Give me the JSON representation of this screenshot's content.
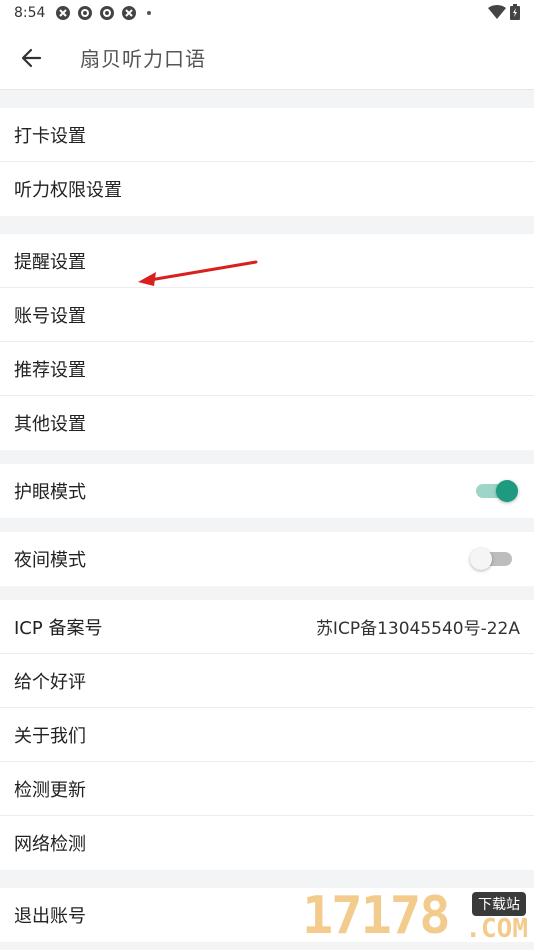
{
  "status_bar": {
    "time": "8:54",
    "icons": [
      "app-icon-1",
      "app-icon-2",
      "app-icon-3",
      "app-icon-4"
    ],
    "right_icons": [
      "wifi-icon",
      "battery-icon"
    ]
  },
  "header": {
    "title": "扇贝听力口语",
    "back_icon": "arrow-left-icon"
  },
  "groups": [
    {
      "items": [
        {
          "label": "打卡设置"
        },
        {
          "label": "听力权限设置"
        }
      ]
    },
    {
      "items": [
        {
          "label": "提醒设置"
        },
        {
          "label": "账号设置"
        },
        {
          "label": "推荐设置"
        },
        {
          "label": "其他设置"
        }
      ]
    },
    {
      "items": [
        {
          "label": "护眼模式",
          "toggle": true,
          "enabled": true
        }
      ]
    },
    {
      "items": [
        {
          "label": "夜间模式",
          "toggle": true,
          "enabled": false
        }
      ]
    },
    {
      "items": [
        {
          "label": "ICP 备案号",
          "value": "苏ICP备13045540号-22A"
        },
        {
          "label": "给个好评"
        },
        {
          "label": "关于我们"
        },
        {
          "label": "检测更新"
        },
        {
          "label": "网络检测"
        }
      ]
    },
    {
      "items": [
        {
          "label": "退出账号"
        }
      ]
    }
  ],
  "colors": {
    "accent": "#1e9a80",
    "accent_track": "#9dd5c8",
    "annotation_arrow": "#d9201f",
    "background": "#f2f4f5"
  },
  "watermark": {
    "number": "17178",
    "tag": "下载站",
    "domain": ".COM"
  }
}
